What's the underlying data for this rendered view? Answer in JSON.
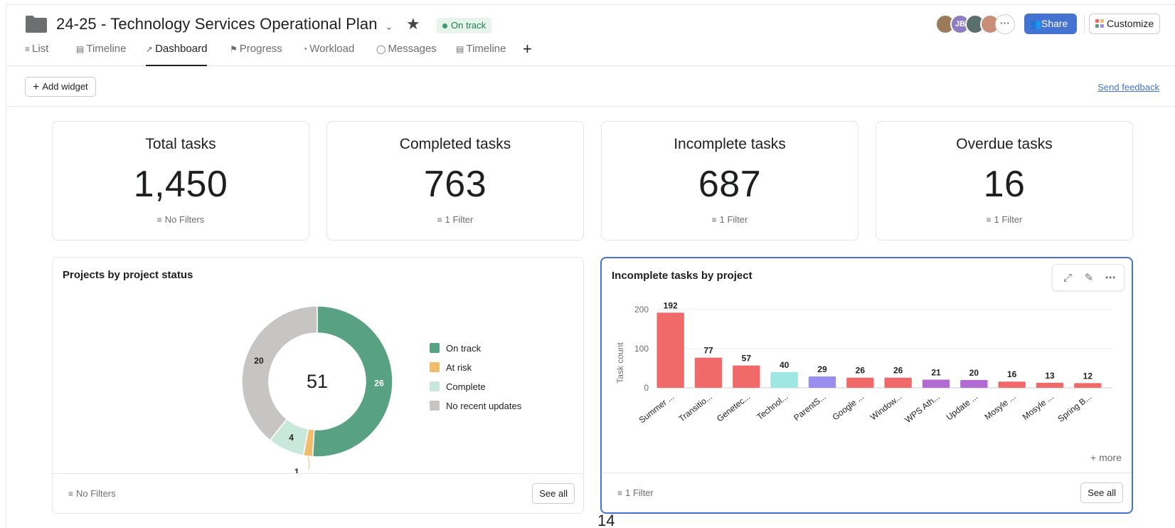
{
  "project": {
    "title": "24-25 - Technology Services Operational Plan",
    "status": "On track",
    "status_color": "#3a9c6d",
    "folder_icon": "folder-icon"
  },
  "header": {
    "avatars": [
      {
        "initials": "",
        "color": "#9b7b5a"
      },
      {
        "initials": "JB",
        "color": "#8e7cc3"
      },
      {
        "initials": "",
        "color": "#5b6f6a"
      },
      {
        "initials": "",
        "color": "#c98e7a"
      }
    ],
    "avatars_more": "···",
    "share_label": "Share",
    "customize_label": "Customize",
    "accent_color": "#4573d2"
  },
  "tabs": [
    {
      "label": "List",
      "icon": "list-icon"
    },
    {
      "label": "Timeline",
      "icon": "timeline-icon"
    },
    {
      "label": "Dashboard",
      "icon": "dashboard-icon",
      "active": true
    },
    {
      "label": "Progress",
      "icon": "progress-icon"
    },
    {
      "label": "Workload",
      "icon": "workload-icon"
    },
    {
      "label": "Messages",
      "icon": "messages-icon"
    },
    {
      "label": "Timeline",
      "icon": "timeline-icon"
    }
  ],
  "toolbar": {
    "add_widget_label": "Add widget",
    "feedback_label": "Send feedback"
  },
  "stats": [
    {
      "label": "Total tasks",
      "value": "1,450",
      "filter": "No Filters"
    },
    {
      "label": "Completed tasks",
      "value": "763",
      "filter": "1 Filter"
    },
    {
      "label": "Incomplete tasks",
      "value": "687",
      "filter": "1 Filter"
    },
    {
      "label": "Overdue tasks",
      "value": "16",
      "filter": "1 Filter"
    }
  ],
  "status_widget": {
    "title": "Projects by project status",
    "filter": "No Filters",
    "see_all": "See all"
  },
  "project_widget": {
    "title": "Incomplete tasks by project",
    "filter": "1 Filter",
    "see_all": "See all",
    "more": "+ more"
  },
  "page_number": "14",
  "chart_data": [
    {
      "type": "pie",
      "title": "Projects by project status",
      "center_label": "51",
      "slices": [
        {
          "name": "On track",
          "value": 26,
          "color": "#58a182"
        },
        {
          "name": "At risk",
          "value": 1,
          "color": "#f1bd6c"
        },
        {
          "name": "Complete",
          "value": 4,
          "color": "#c9e8dc"
        },
        {
          "name": "No recent updates",
          "value": 20,
          "color": "#c7c4c4"
        }
      ],
      "legend": "right"
    },
    {
      "type": "bar",
      "title": "Incomplete tasks by project",
      "ylabel": "Task count",
      "xlabel": "",
      "ylim": [
        0,
        200
      ],
      "yticks": [
        0,
        100,
        200
      ],
      "grid": true,
      "categories": [
        "Summer ...",
        "Transitio...",
        "Genetec...",
        "Technol...",
        "ParentS...",
        "Google ...",
        "Window...",
        "WPS Ath...",
        "Update ...",
        "Mosyle ...",
        "Mosyle ...",
        "Spring B..."
      ],
      "values": [
        192,
        77,
        57,
        40,
        29,
        26,
        26,
        21,
        20,
        16,
        13,
        12
      ],
      "colors": [
        "#f06a6a",
        "#f06a6a",
        "#f06a6a",
        "#9ee7e3",
        "#9a8ef0",
        "#f06a6a",
        "#f06a6a",
        "#b36bd4",
        "#b36bd4",
        "#f06a6a",
        "#f06a6a",
        "#f06a6a"
      ]
    }
  ]
}
